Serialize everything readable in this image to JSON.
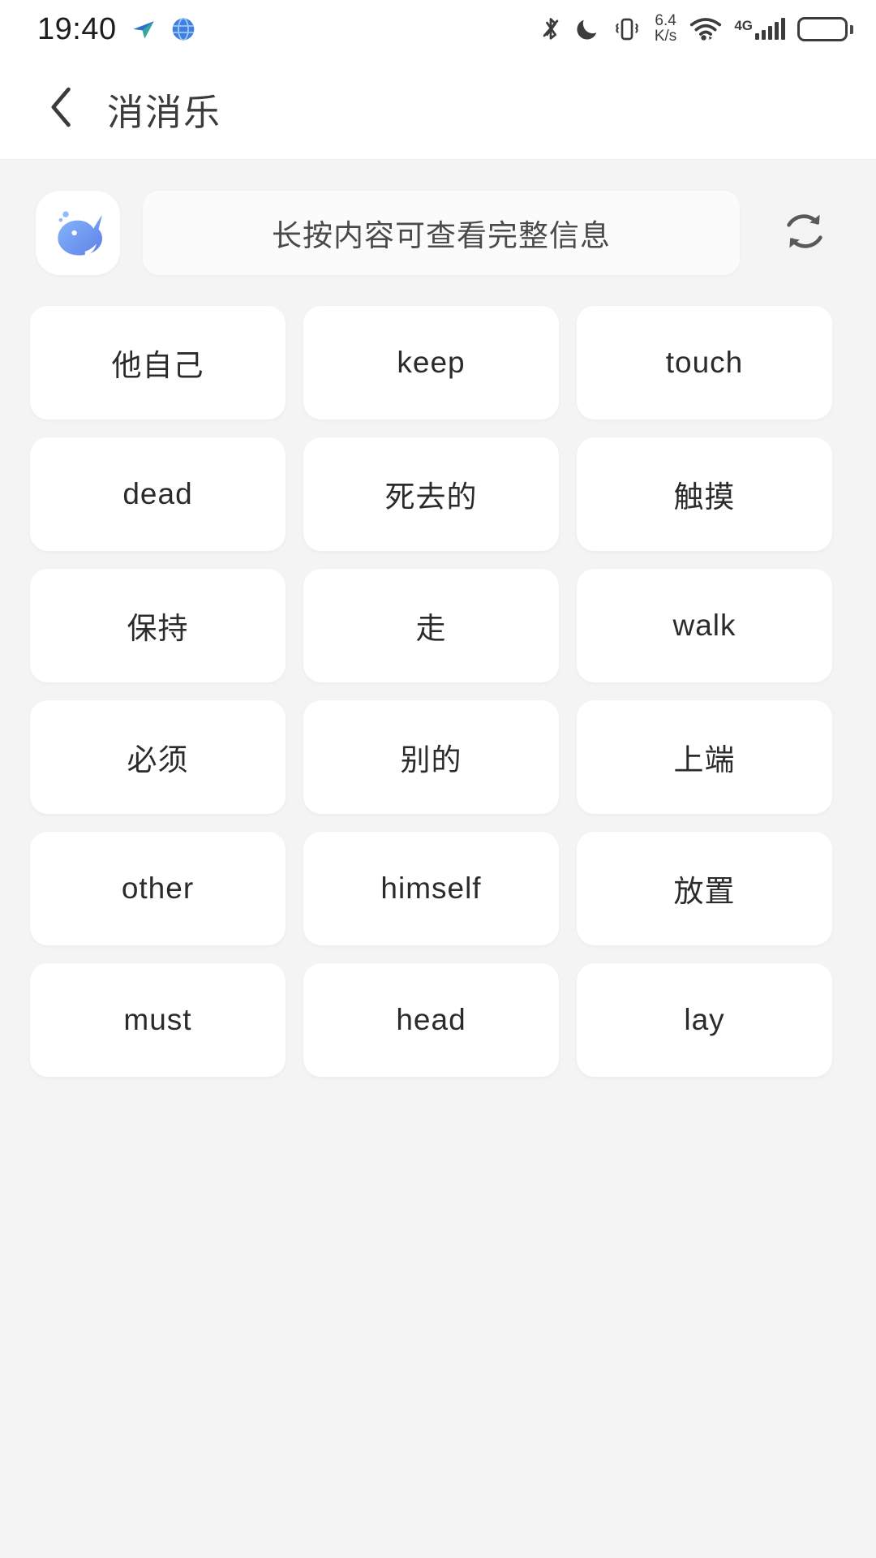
{
  "status_bar": {
    "time": "19:40",
    "network_speed_value": "6.4",
    "network_speed_unit": "K/s",
    "mobile_network_label": "4G",
    "icons": [
      "send-icon",
      "browser-globe-icon",
      "bluetooth-icon",
      "do-not-disturb-moon-icon",
      "vibrate-icon",
      "network-speed-icon",
      "wifi-icon",
      "cellular-signal-icon",
      "battery-icon"
    ]
  },
  "header": {
    "back_icon": "chevron-left-icon",
    "title": "消消乐"
  },
  "toolbar": {
    "logo_icon": "whale-logo-icon",
    "hint_text": "长按内容可查看完整信息",
    "refresh_icon": "refresh-icon"
  },
  "grid": {
    "columns": 3,
    "cards": [
      {
        "label": "他自己"
      },
      {
        "label": "keep"
      },
      {
        "label": "touch"
      },
      {
        "label": "dead"
      },
      {
        "label": "死去的"
      },
      {
        "label": "触摸"
      },
      {
        "label": "保持"
      },
      {
        "label": "走"
      },
      {
        "label": "walk"
      },
      {
        "label": "必须"
      },
      {
        "label": "别的"
      },
      {
        "label": "上端"
      },
      {
        "label": "other"
      },
      {
        "label": "himself"
      },
      {
        "label": "放置"
      },
      {
        "label": "must"
      },
      {
        "label": "head"
      },
      {
        "label": "lay"
      }
    ]
  },
  "colors": {
    "page_background": "#f4f4f4",
    "card_background": "#ffffff",
    "header_background": "#ffffff",
    "text_primary": "#2b2b2b",
    "text_secondary": "#4a4a4a",
    "whale_blue": "#5b8cf5",
    "whale_light_blue": "#7fb2f7"
  }
}
